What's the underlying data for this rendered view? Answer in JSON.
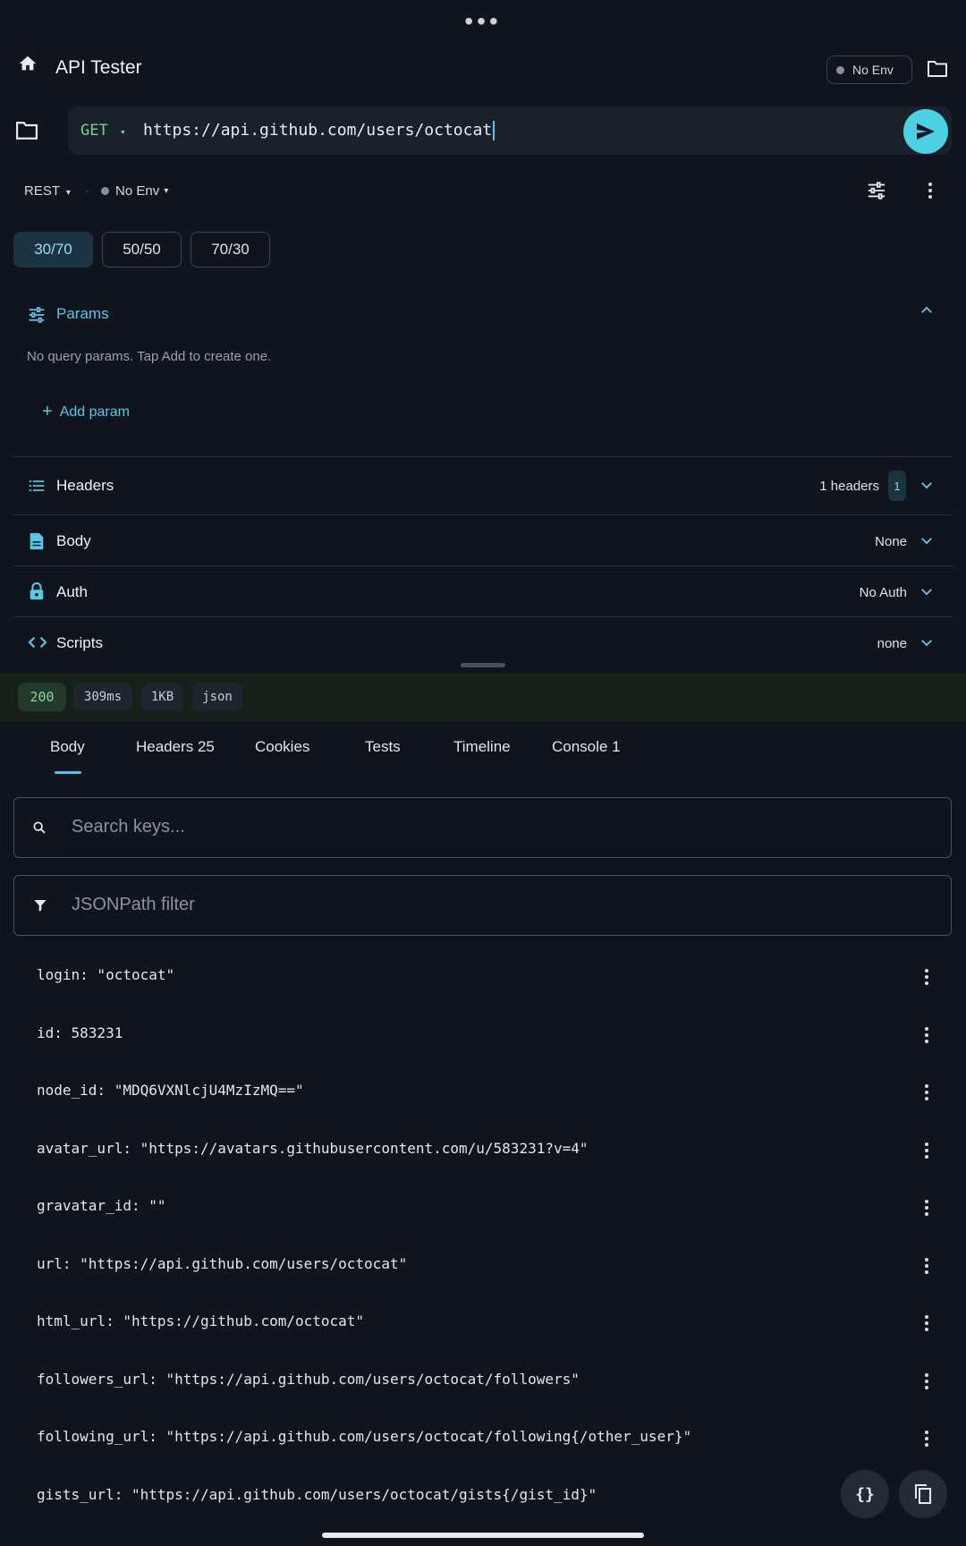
{
  "top_menu_glyph": "•••",
  "app": {
    "title": "API Tester",
    "env_pill": "No Env"
  },
  "request": {
    "method": "GET",
    "url": "https://api.github.com/users/octocat"
  },
  "mode": {
    "type": "REST",
    "separator": "·",
    "env": "No Env"
  },
  "split_options": [
    {
      "label": "30/70",
      "active": true
    },
    {
      "label": "50/50",
      "active": false
    },
    {
      "label": "70/30",
      "active": false
    }
  ],
  "params": {
    "title": "Params",
    "empty_text": "No query params. Tap Add to create one.",
    "add_label": "Add param"
  },
  "sections": {
    "headers": {
      "title": "Headers",
      "meta": "1 headers",
      "badge": "1"
    },
    "body": {
      "title": "Body",
      "meta": "None"
    },
    "auth": {
      "title": "Auth",
      "meta": "No Auth"
    },
    "scripts": {
      "title": "Scripts",
      "meta": "none"
    }
  },
  "response": {
    "status": "200",
    "time": "309ms",
    "size": "1KB",
    "format": "json",
    "tabs": [
      "Body",
      "Headers 25",
      "Cookies",
      "Tests",
      "Timeline",
      "Console 1"
    ],
    "search_placeholder": "Search keys...",
    "filter_placeholder": "JSONPath filter",
    "rows": [
      "login: \"octocat\"",
      "id: 583231",
      "node_id: \"MDQ6VXNlcjU4MzIzMQ==\"",
      "avatar_url: \"https://avatars.githubusercontent.com/u/583231?v=4\"",
      "gravatar_id: \"\"",
      "url: \"https://api.github.com/users/octocat\"",
      "html_url: \"https://github.com/octocat\"",
      "followers_url: \"https://api.github.com/users/octocat/followers\"",
      "following_url: \"https://api.github.com/users/octocat/following{/other_user}\"",
      "gists_url: \"https://api.github.com/users/octocat/gists{/gist_id}\""
    ]
  },
  "colors": {
    "accent": "#4dd0e1",
    "background": "#10141d",
    "success": "#8fd39a"
  }
}
